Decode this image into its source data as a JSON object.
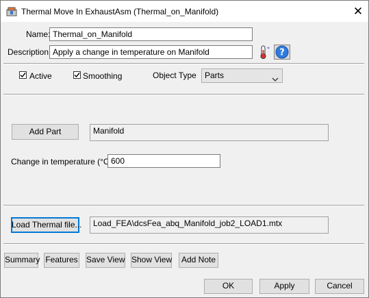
{
  "window": {
    "title": "Thermal Move In ExhaustAsm (Thermal_on_Manifold)",
    "close_icon": "close-icon",
    "app_icon": "thermal-app-icon"
  },
  "form": {
    "name_label": "Name:",
    "name_value": "Thermal_on_Manifold",
    "description_label": "Description:",
    "description_value": "Apply a change in temperature on Manifold"
  },
  "options": {
    "active_label": "Active",
    "active_checked": true,
    "smoothing_label": "Smoothing",
    "smoothing_checked": true,
    "object_type_label": "Object Type",
    "object_type_value": "Parts"
  },
  "parts": {
    "add_part_label": "Add Part",
    "part_value": "Manifold",
    "temp_label": "Change in temperature (°C):",
    "temp_value": "600"
  },
  "thermal": {
    "load_label": "Load Thermal file...",
    "file_value": "Load_FEA\\dcsFea_abq_Manifold_job2_LOAD1.mtx"
  },
  "toolbar": {
    "summary": "Summary",
    "features": "Features",
    "save_view": "Save View",
    "show_view": "Show View",
    "add_note": "Add Note"
  },
  "footer": {
    "ok": "OK",
    "apply": "Apply",
    "cancel": "Cancel"
  }
}
